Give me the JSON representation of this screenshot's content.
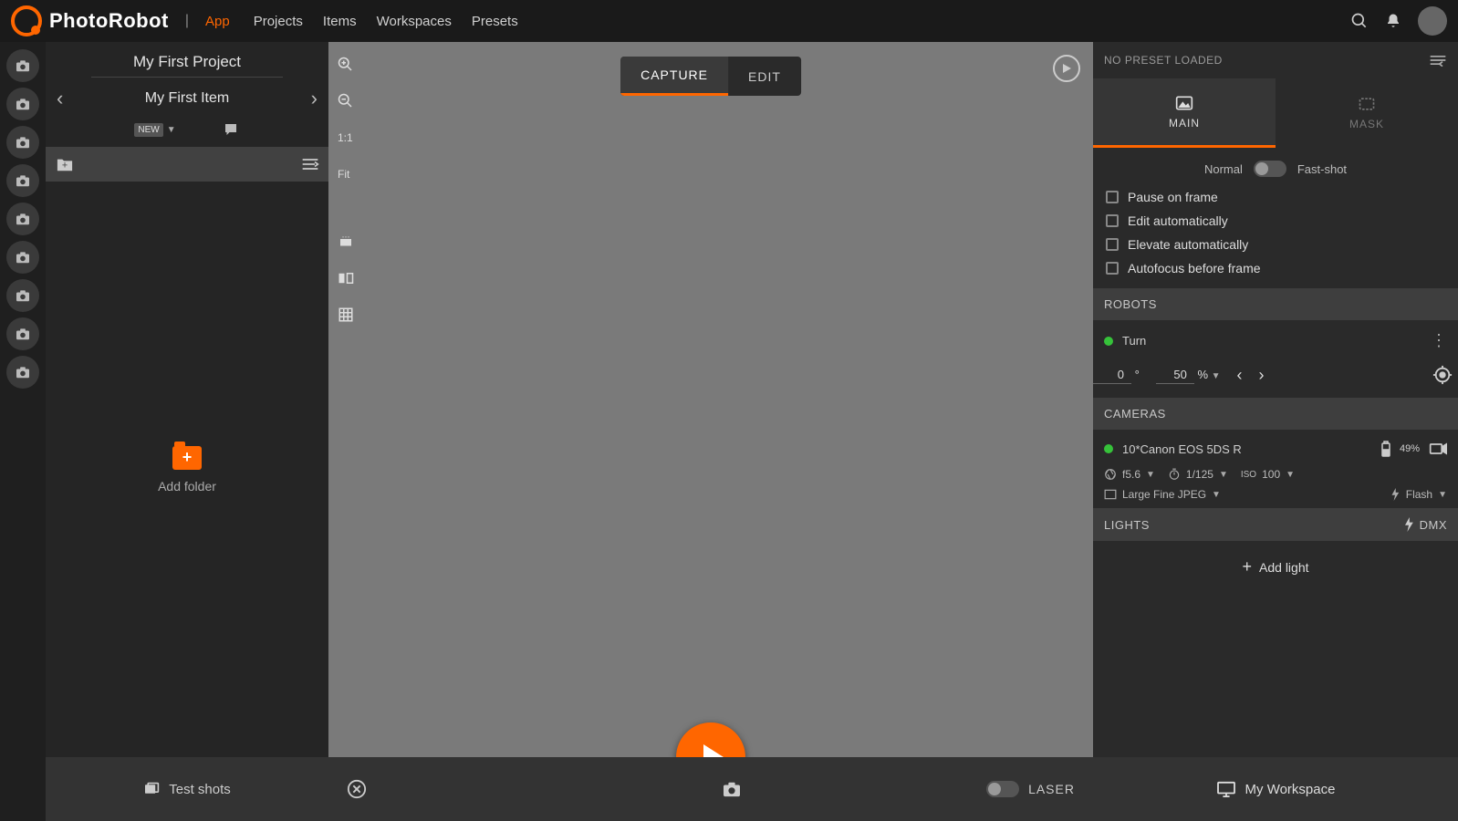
{
  "brand": {
    "name": "PhotoRobot",
    "app_label": "App"
  },
  "nav": {
    "projects": "Projects",
    "items": "Items",
    "workspaces": "Workspaces",
    "presets": "Presets"
  },
  "left": {
    "project_title": "My First Project",
    "item_title": "My First Item",
    "new_badge": "NEW",
    "add_folder": "Add folder",
    "test_shots": "Test shots"
  },
  "center": {
    "zoom_one": "1:1",
    "zoom_fit": "Fit",
    "capture": "CAPTURE",
    "edit": "EDIT",
    "laser": "LASER"
  },
  "right": {
    "preset_status": "NO PRESET LOADED",
    "tab_main": "MAIN",
    "tab_mask": "MASK",
    "mode_normal": "Normal",
    "mode_fast": "Fast-shot",
    "chk_pause": "Pause on frame",
    "chk_edit_auto": "Edit automatically",
    "chk_elevate": "Elevate automatically",
    "chk_af": "Autofocus before frame",
    "robots_h": "ROBOTS",
    "robot_name": "Turn",
    "turn_deg": "0",
    "turn_deg_unit": "°",
    "turn_speed": "50",
    "turn_speed_unit": "%",
    "cameras_h": "CAMERAS",
    "camera_name": "10*Canon EOS 5DS R",
    "battery": "49%",
    "aperture": "f5.6",
    "shutter": "1/125",
    "iso_label": "ISO",
    "iso_value": "100",
    "format": "Large Fine JPEG",
    "flash": "Flash",
    "lights_h": "LIGHTS",
    "dmx": "DMX",
    "add_light": "Add light",
    "workspace": "My Workspace"
  }
}
